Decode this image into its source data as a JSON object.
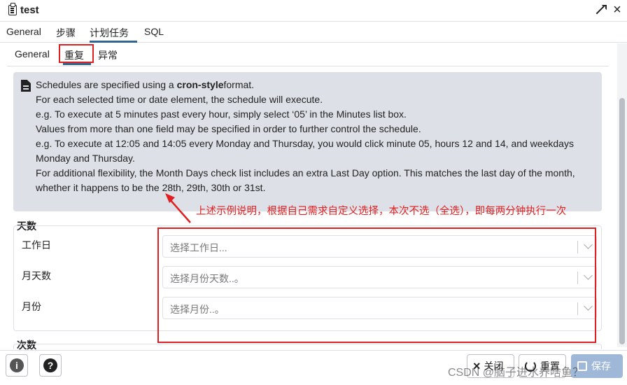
{
  "window": {
    "title": "test"
  },
  "main_tabs": [
    "General",
    "步骤",
    "计划任务",
    "SQL"
  ],
  "sub_tabs": [
    "General",
    "重复",
    "异常"
  ],
  "info": {
    "line1_pre": "Schedules are specified using a ",
    "line1_bold": "cron-style",
    "line1_post": "format.",
    "lines": [
      "For each selected time or date element, the schedule will execute.",
      "e.g. To execute at 5 minutes past every hour, simply select ‘05’ in the Minutes list box.",
      "Values from more than one field may be specified in order to further control the schedule.",
      "e.g. To execute at 12:05 and 14:05 every Monday and Thursday, you would click minute 05, hours 12 and 14, and weekdays",
      "Monday and Thursday.",
      "For additional flexibility, the Month Days check list includes an extra Last Day option. This matches the last day of the month,",
      "whether it happens to be the 28th, 29th, 30th or 31st."
    ]
  },
  "annotation": "上述示例说明，根据自己需求自定义选择，本次不选（全选），即每两分钟执行一次",
  "days_section": {
    "legend": "天数",
    "fields": [
      {
        "label": "工作日",
        "placeholder": "选择工作日..."
      },
      {
        "label": "月天数",
        "placeholder": "选择月份天数..。"
      },
      {
        "label": "月份",
        "placeholder": "选择月份..。"
      }
    ]
  },
  "times_section": {
    "legend": "次数"
  },
  "footer": {
    "info_icon": "i",
    "help_icon": "?",
    "close_label": "关闭",
    "reset_label": "重置",
    "save_label": "保存"
  },
  "watermark": "CSDN @脑子进水养啥鱼？",
  "colors": {
    "accent": "#326690",
    "annotation": "#e02020",
    "info_bg": "#dde0e6"
  }
}
